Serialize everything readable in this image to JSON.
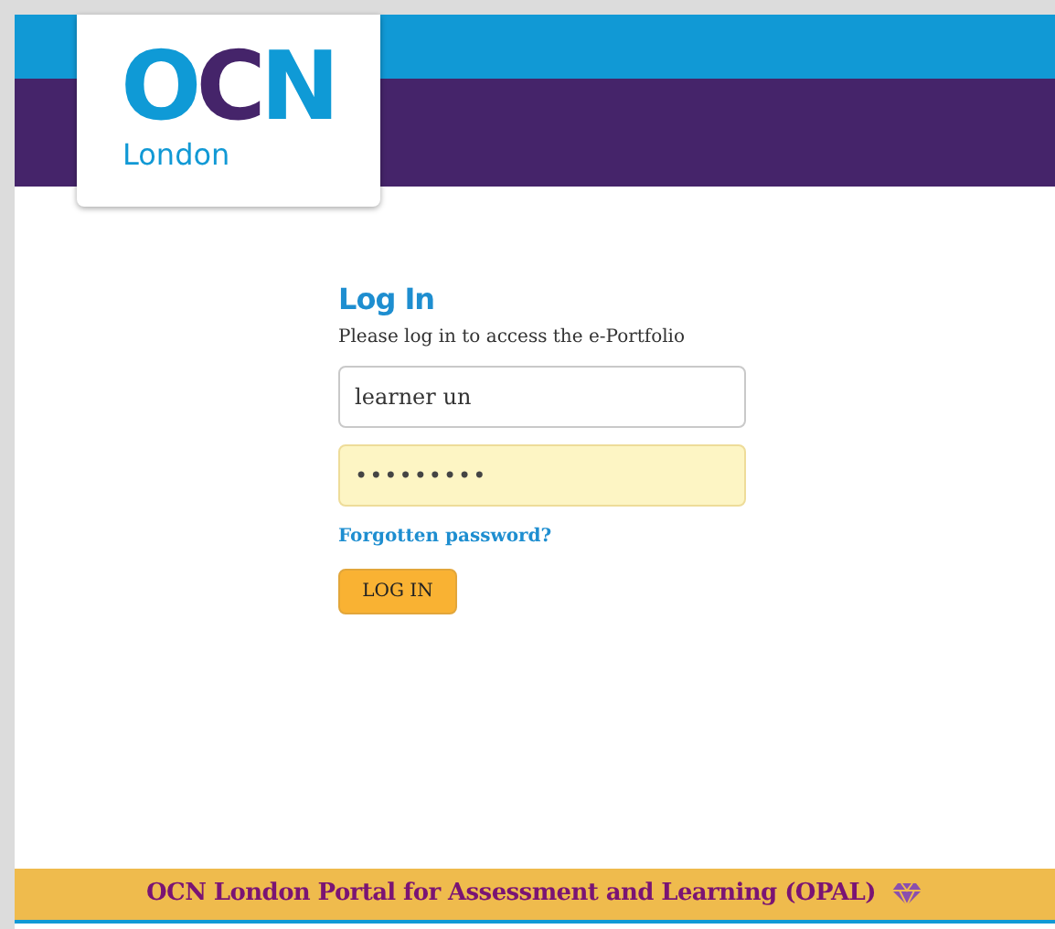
{
  "logo": {
    "letters": [
      {
        "text": "O",
        "color": "#0f9ad6"
      },
      {
        "text": "C",
        "color": "#45246a"
      },
      {
        "text": "N",
        "color": "#0f9ad6"
      }
    ],
    "subtitle": "London"
  },
  "login": {
    "title": "Log In",
    "subtitle": "Please log in to access the e-Portfolio",
    "fields": [
      {
        "kind": "text",
        "value": "learner un",
        "autofilled": false
      },
      {
        "kind": "password",
        "value": "•••••••••",
        "autofilled": true
      }
    ],
    "forgot_link": "Forgotten password?",
    "button": "LOG IN"
  },
  "footer": {
    "text": "OCN London Portal for Assessment and Learning (OPAL)"
  }
}
